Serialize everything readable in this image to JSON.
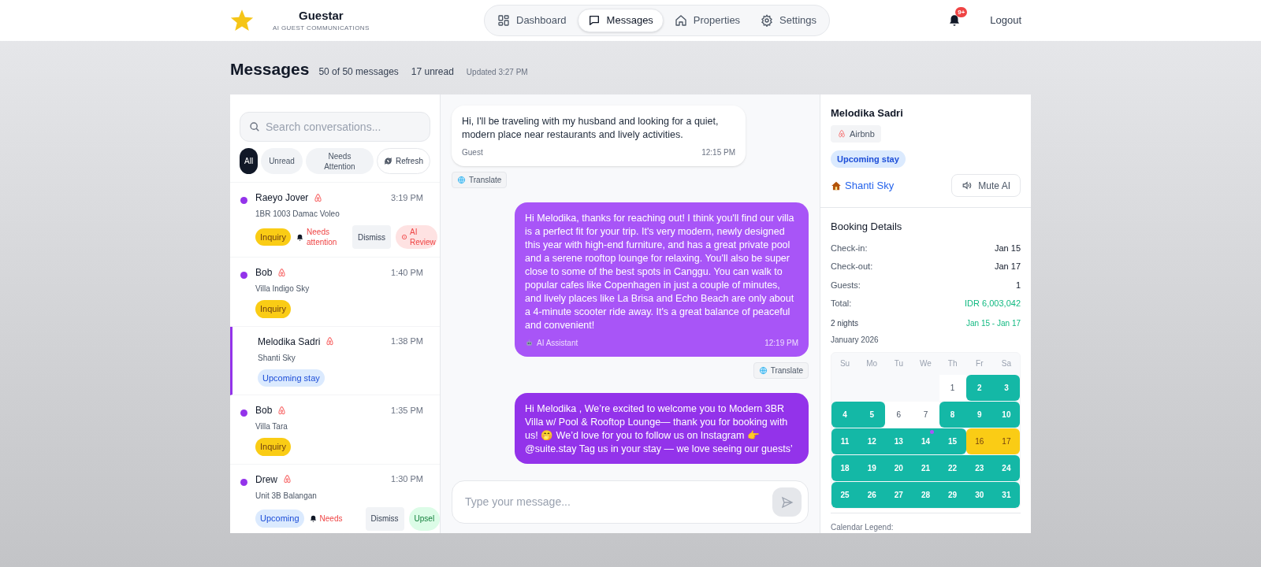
{
  "header": {
    "brand": "Guestar",
    "tagline": "AI GUEST COMMUNICATIONS",
    "nav": [
      {
        "label": "Dashboard",
        "selected": false
      },
      {
        "label": "Messages",
        "selected": true
      },
      {
        "label": "Properties",
        "selected": false
      },
      {
        "label": "Settings",
        "selected": false
      }
    ],
    "notification_badge": "9+",
    "logout": "Logout"
  },
  "page": {
    "title": "Messages",
    "count": "50 of 50 messages",
    "unread": "17 unread",
    "updated": "Updated 3:27 PM"
  },
  "sidebar": {
    "search_placeholder": "Search conversations...",
    "filters": [
      {
        "label": "All",
        "selected": true
      },
      {
        "label": "Unread",
        "selected": false
      },
      {
        "label": "Needs Attention",
        "selected": false
      }
    ],
    "refresh": "Refresh",
    "conversations": [
      {
        "name": "Raeyo Jover",
        "property": "1BR 1003 Damac Voleo",
        "time": "3:19 PM",
        "unread": true,
        "selected": false,
        "tag": {
          "label": "Inquiry",
          "kind": "inquiry"
        },
        "alert": "Needs attention",
        "actions": [
          {
            "label": "Dismiss",
            "kind": "dismiss"
          },
          {
            "label": "AI Review",
            "kind": "review"
          }
        ]
      },
      {
        "name": "Bob",
        "property": "Villa Indigo Sky",
        "time": "1:40 PM",
        "unread": true,
        "selected": false,
        "tag": {
          "label": "Inquiry",
          "kind": "inquiry"
        }
      },
      {
        "name": "Melodika Sadri",
        "property": "Shanti Sky",
        "time": "1:38 PM",
        "unread": false,
        "selected": true,
        "tag": {
          "label": "Upcoming stay",
          "kind": "upcoming"
        }
      },
      {
        "name": "Bob",
        "property": "Villa Tara",
        "time": "1:35 PM",
        "unread": true,
        "selected": false,
        "tag": {
          "label": "Inquiry",
          "kind": "inquiry"
        }
      },
      {
        "name": "Drew",
        "property": "Unit 3B Balangan",
        "time": "1:30 PM",
        "unread": true,
        "selected": false,
        "tag": {
          "label": "Upcoming",
          "kind": "upcoming"
        },
        "alert": "Needs",
        "actions": [
          {
            "label": "Dismiss",
            "kind": "dismiss"
          },
          {
            "label": "Upsel",
            "kind": "upsell"
          }
        ]
      }
    ]
  },
  "chat": {
    "messages": [
      {
        "kind": "guest",
        "text": "Hi, I'll be traveling with my husband and looking for a quiet, modern place near restaurants and lively activities.",
        "sender": "Guest",
        "time": "12:15 PM",
        "translate": "Translate"
      },
      {
        "kind": "ai",
        "text": "Hi Melodika, thanks for reaching out! I think you'll find our villa is a perfect fit for your trip. It's very modern, newly designed this year with high-end furniture, and has a great private pool and a serene rooftop lounge for relaxing. You'll also be super close to some of the best spots in Canggu. You can walk to popular cafes like Copenhagen in just a couple of minutes, and lively places like La Brisa and Echo Beach are only about a 4-minute scooter ride away. It's a great balance of peaceful and convenient!",
        "sender": "AI Assistant",
        "time": "12:19 PM",
        "translate": "Translate"
      },
      {
        "kind": "host",
        "text": "Hi Melodika , We’re excited to welcome you to Modern 3BR Villa w/ Pool & Rooftop Lounge— thank you for booking with us! 🤭 We’d love for you to follow us on Instagram 👉 @suite.stay Tag us in your stay — we love seeing our guests’"
      }
    ],
    "input_placeholder": "Type your message..."
  },
  "details": {
    "guest": "Melodika Sadri",
    "channel": "Airbnb",
    "status": "Upcoming stay",
    "property": "Shanti Sky",
    "mute": "Mute AI",
    "booking_title": "Booking Details",
    "rows": [
      {
        "label": "Check-in:",
        "value": "Jan 15",
        "kind": "plain"
      },
      {
        "label": "Check-out:",
        "value": "Jan 17",
        "kind": "plain"
      },
      {
        "label": "Guests:",
        "value": "1",
        "kind": "plain"
      },
      {
        "label": "Total:",
        "value": "IDR 6,003,042",
        "kind": "money"
      }
    ],
    "nights": "2 nights",
    "range": "Jan 15 - Jan 17",
    "calendar": {
      "month": "January 2026",
      "weekdays": [
        "Su",
        "Mo",
        "Tu",
        "We",
        "Th",
        "Fr",
        "Sa"
      ],
      "days": [
        {
          "day": "1",
          "kind": "open",
          "today": false
        },
        {
          "day": "2",
          "kind": "booked",
          "today": false
        },
        {
          "day": "3",
          "kind": "booked",
          "today": false
        },
        {
          "day": "4",
          "kind": "booked",
          "today": false
        },
        {
          "day": "5",
          "kind": "booked",
          "today": false
        },
        {
          "day": "6",
          "kind": "open",
          "today": false
        },
        {
          "day": "7",
          "kind": "open",
          "today": false
        },
        {
          "day": "8",
          "kind": "booked",
          "today": false
        },
        {
          "day": "9",
          "kind": "booked",
          "today": false
        },
        {
          "day": "10",
          "kind": "booked",
          "today": false
        },
        {
          "day": "11",
          "kind": "booked",
          "today": false
        },
        {
          "day": "12",
          "kind": "booked",
          "today": false
        },
        {
          "day": "13",
          "kind": "booked",
          "today": false
        },
        {
          "day": "14",
          "kind": "booked",
          "today": true
        },
        {
          "day": "15",
          "kind": "booked",
          "today": false
        },
        {
          "day": "16",
          "kind": "stay",
          "today": false
        },
        {
          "day": "17",
          "kind": "stay",
          "today": false
        },
        {
          "day": "18",
          "kind": "booked",
          "today": false
        },
        {
          "day": "19",
          "kind": "booked",
          "today": false
        },
        {
          "day": "20",
          "kind": "booked",
          "today": false
        },
        {
          "day": "21",
          "kind": "booked",
          "today": false
        },
        {
          "day": "22",
          "kind": "booked",
          "today": false
        },
        {
          "day": "23",
          "kind": "booked",
          "today": false
        },
        {
          "day": "24",
          "kind": "booked",
          "today": false
        },
        {
          "day": "25",
          "kind": "booked",
          "today": false
        },
        {
          "day": "26",
          "kind": "booked",
          "today": false
        },
        {
          "day": "27",
          "kind": "booked",
          "today": false
        },
        {
          "day": "28",
          "kind": "booked",
          "today": false
        },
        {
          "day": "29",
          "kind": "booked",
          "today": false
        },
        {
          "day": "30",
          "kind": "booked",
          "today": false
        },
        {
          "day": "31",
          "kind": "booked",
          "today": false
        }
      ]
    },
    "legend_title": "Calendar Legend:"
  }
}
